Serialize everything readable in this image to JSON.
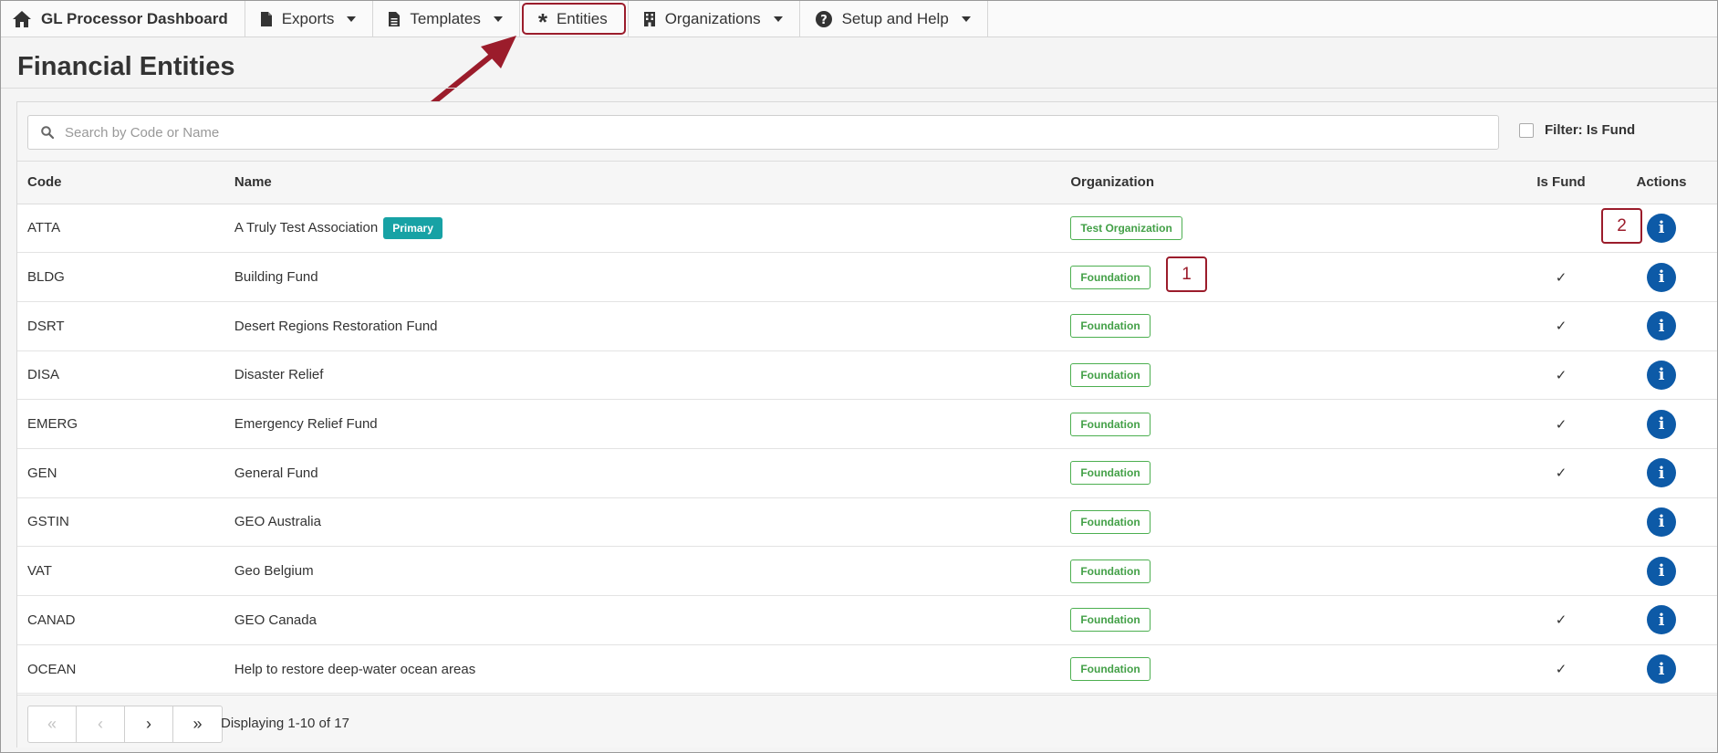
{
  "navbar": {
    "brand": "GL Processor Dashboard",
    "items": [
      {
        "label": "Exports"
      },
      {
        "label": "Templates"
      },
      {
        "label": "Entities"
      },
      {
        "label": "Organizations"
      },
      {
        "label": "Setup and Help"
      }
    ]
  },
  "page": {
    "title": "Financial Entities"
  },
  "search": {
    "placeholder": "Search by Code or Name",
    "value": ""
  },
  "filter": {
    "label": "Filter: Is Fund",
    "checked": false
  },
  "table": {
    "headers": {
      "code": "Code",
      "name": "Name",
      "organization": "Organization",
      "is_fund": "Is Fund",
      "actions": "Actions"
    },
    "rows": [
      {
        "code": "ATTA",
        "name": "A Truly Test Association",
        "badge": "Primary",
        "organization": "Test Organization",
        "is_fund": ""
      },
      {
        "code": "BLDG",
        "name": "Building Fund",
        "badge": "",
        "organization": "Foundation",
        "is_fund": "✓"
      },
      {
        "code": "DSRT",
        "name": "Desert Regions Restoration Fund",
        "badge": "",
        "organization": "Foundation",
        "is_fund": "✓"
      },
      {
        "code": "DISA",
        "name": "Disaster Relief",
        "badge": "",
        "organization": "Foundation",
        "is_fund": "✓"
      },
      {
        "code": "EMERG",
        "name": "Emergency Relief Fund",
        "badge": "",
        "organization": "Foundation",
        "is_fund": "✓"
      },
      {
        "code": "GEN",
        "name": "General Fund",
        "badge": "",
        "organization": "Foundation",
        "is_fund": "✓"
      },
      {
        "code": "GSTIN",
        "name": "GEO Australia",
        "badge": "",
        "organization": "Foundation",
        "is_fund": ""
      },
      {
        "code": "VAT",
        "name": "Geo Belgium",
        "badge": "",
        "organization": "Foundation",
        "is_fund": ""
      },
      {
        "code": "CANAD",
        "name": "GEO Canada",
        "badge": "",
        "organization": "Foundation",
        "is_fund": "✓"
      },
      {
        "code": "OCEAN",
        "name": "Help to restore deep-water ocean areas",
        "badge": "",
        "organization": "Foundation",
        "is_fund": "✓"
      }
    ],
    "action_icon": "info-icon"
  },
  "pagination": {
    "first": "«",
    "prev": "‹",
    "next": "›",
    "last": "»",
    "status": "Displaying 1-10 of 17"
  },
  "callouts": {
    "one": "1",
    "two": "2"
  },
  "colors": {
    "accent_red": "#9b1c2b",
    "info_blue": "#0d5aa7",
    "primary_teal": "#17a2a5",
    "org_green": "#43a047"
  }
}
